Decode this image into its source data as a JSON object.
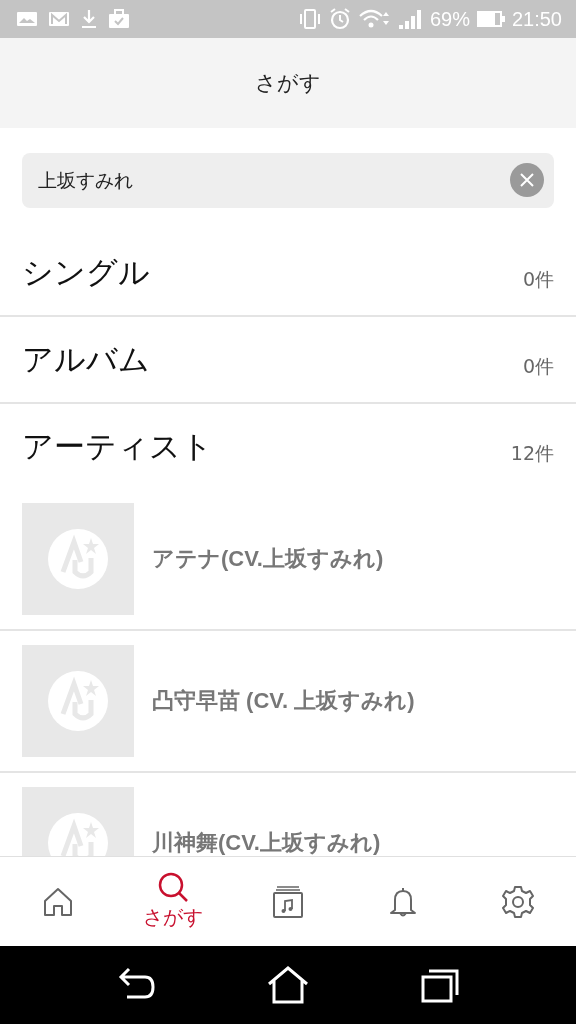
{
  "status_bar": {
    "battery": "69%",
    "time": "21:50"
  },
  "header": {
    "title": "さがす"
  },
  "search": {
    "value": "上坂すみれ"
  },
  "sections": [
    {
      "title": "シングル",
      "count": "0件"
    },
    {
      "title": "アルバム",
      "count": "0件"
    },
    {
      "title": "アーティスト",
      "count": "12件"
    }
  ],
  "artists": [
    {
      "name": "アテナ(CV.上坂すみれ)"
    },
    {
      "name": "凸守早苗 (CV. 上坂すみれ)"
    },
    {
      "name": "川神舞(CV.上坂すみれ)"
    }
  ],
  "bottom_nav": [
    {
      "kind": "home",
      "selected": false
    },
    {
      "kind": "search",
      "selected": true,
      "label": "さがす"
    },
    {
      "kind": "library",
      "selected": false
    },
    {
      "kind": "bell",
      "selected": false
    },
    {
      "kind": "settings",
      "selected": false
    }
  ]
}
